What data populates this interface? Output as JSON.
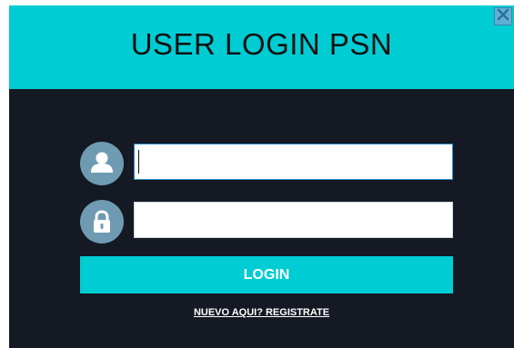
{
  "window": {
    "title": "USER LOGIN PSN"
  },
  "controls": {
    "close_icon": "close-icon"
  },
  "form": {
    "username": {
      "icon": "user-icon",
      "value": ""
    },
    "password": {
      "icon": "lock-icon",
      "value": ""
    },
    "login_label": "LOGIN",
    "register_link": "NUEVO AQUI? REGISTRATE"
  },
  "colors": {
    "accent": "#00ccd3",
    "background": "#141923",
    "avatar": "#6f9bb2",
    "title_text": "#111111",
    "button_text": "#ffffff"
  }
}
